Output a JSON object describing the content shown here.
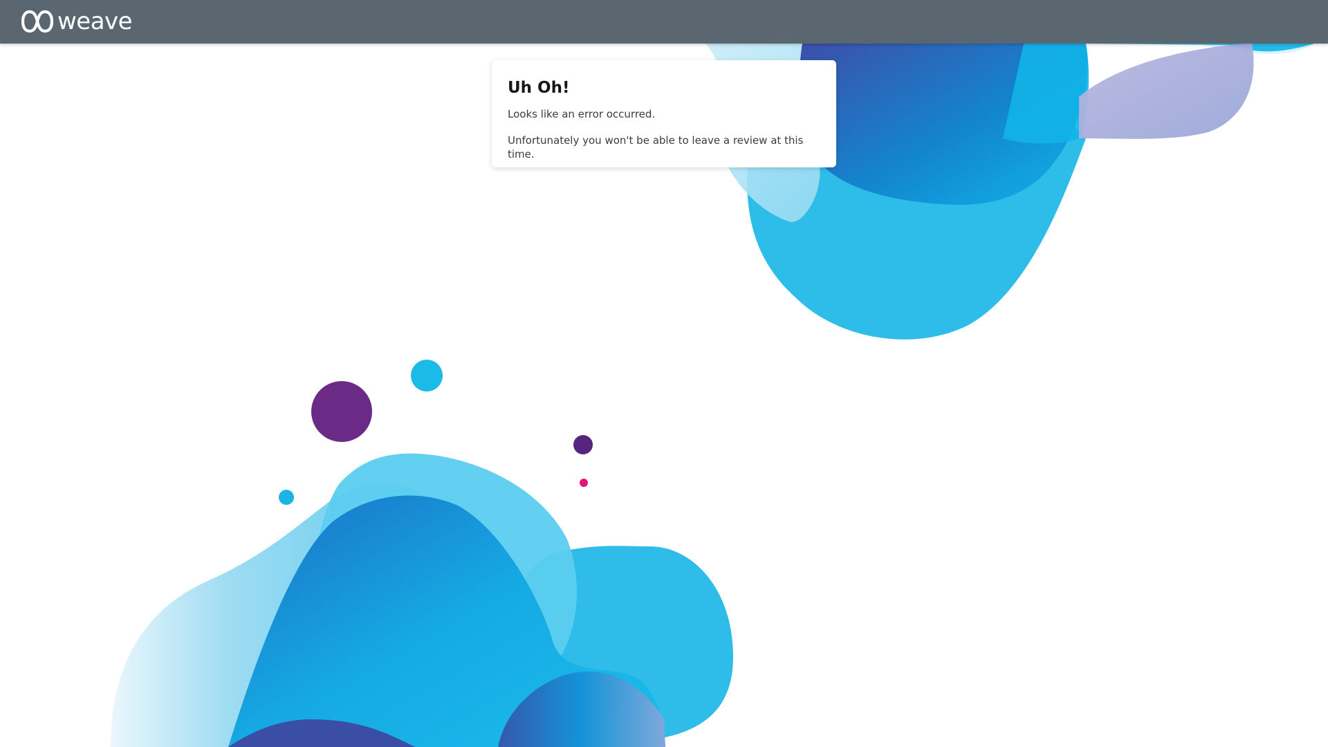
{
  "header": {
    "logo_text": "weave",
    "logo_icon": "weave-logo-icon",
    "background_color": "#5b6770"
  },
  "error_card": {
    "title": "Uh Oh!",
    "message": "Looks like an error occurred.",
    "detail": "Unfortunately you won't be able to leave a review at this time."
  },
  "colors": {
    "accent_cyan": "#1eb8e8",
    "accent_blue": "#3a5ba8",
    "accent_purple": "#6a2a85",
    "accent_pink": "#e0177a"
  }
}
